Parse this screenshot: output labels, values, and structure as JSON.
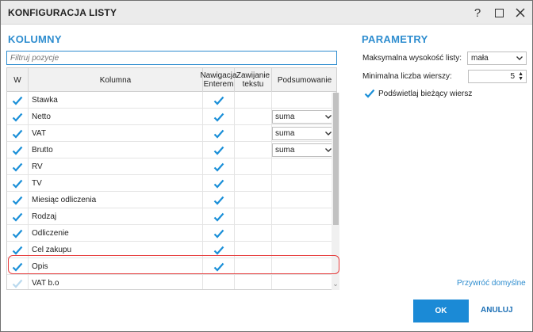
{
  "window": {
    "title": "KONFIGURACJA LISTY",
    "help_label": "?"
  },
  "colors": {
    "accent": "#2e8dcf",
    "check": "#1a8fd8",
    "highlight": "#e63c3c",
    "ok_button": "#1b8ad6"
  },
  "columns_section": {
    "title": "KOLUMNY",
    "filter_placeholder": "Filtruj pozycje",
    "headers": {
      "w": "W",
      "column": "Kolumna",
      "nav": "Nawigacja Enterem",
      "wrap": "Zawijanie tekstu",
      "summary": "Podsumowanie"
    },
    "rows": [
      {
        "name": "Stawka",
        "w": true,
        "nav": true,
        "summary": ""
      },
      {
        "name": "Netto",
        "w": true,
        "nav": true,
        "summary": "suma"
      },
      {
        "name": "VAT",
        "w": true,
        "nav": true,
        "summary": "suma"
      },
      {
        "name": "Brutto",
        "w": true,
        "nav": true,
        "summary": "suma"
      },
      {
        "name": "RV",
        "w": true,
        "nav": true,
        "summary": ""
      },
      {
        "name": "TV",
        "w": true,
        "nav": true,
        "summary": ""
      },
      {
        "name": "Miesiąc odliczenia",
        "w": true,
        "nav": true,
        "summary": ""
      },
      {
        "name": "Rodzaj",
        "w": true,
        "nav": true,
        "summary": ""
      },
      {
        "name": "Odliczenie",
        "w": true,
        "nav": true,
        "summary": ""
      },
      {
        "name": "Cel zakupu",
        "w": true,
        "nav": true,
        "summary": ""
      },
      {
        "name": "Opis",
        "w": true,
        "nav": true,
        "summary": ""
      },
      {
        "name": "VAT b.o",
        "w": false,
        "nav": false,
        "summary": ""
      }
    ]
  },
  "params_section": {
    "title": "PARAMETRY",
    "max_height_label": "Maksymalna wysokość listy:",
    "max_height_value": "mała",
    "min_rows_label": "Minimalna liczba wierszy:",
    "min_rows_value": "5",
    "highlight_row_label": "Podświetlaj bieżący wiersz",
    "highlight_row_checked": true
  },
  "footer": {
    "reset_link": "Przywróć domyślne",
    "ok_label": "OK",
    "cancel_label": "ANULUJ"
  }
}
